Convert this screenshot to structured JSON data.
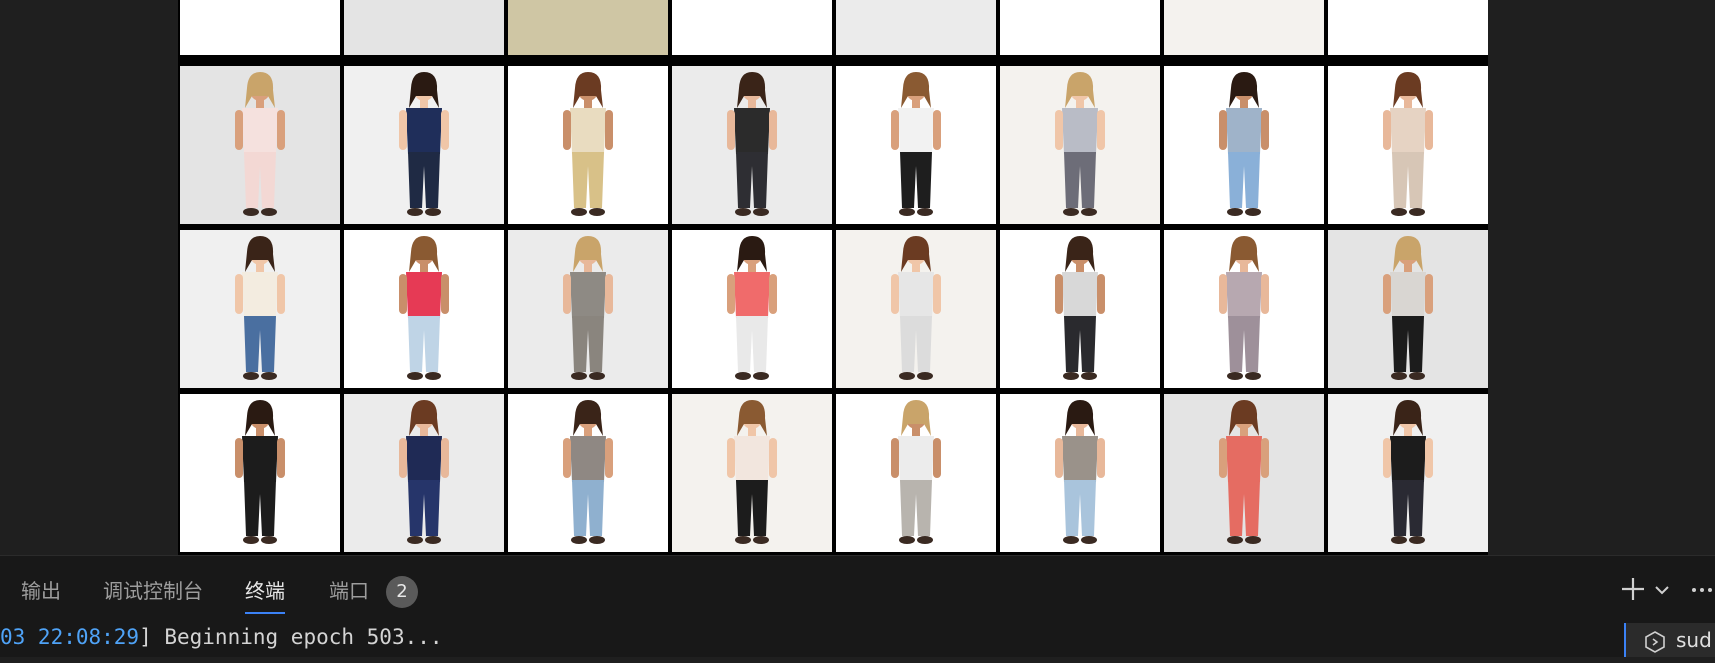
{
  "panel": {
    "tabs": [
      {
        "label": "输出",
        "active": false
      },
      {
        "label": "调试控制台",
        "active": false
      },
      {
        "label": "终端",
        "active": true
      },
      {
        "label": "端口",
        "active": false
      }
    ],
    "ports_badge": "2",
    "new_terminal_icon": "plus-icon",
    "dropdown_icon": "chevron-down-icon",
    "more_icon": "ellipsis-icon",
    "accent_color": "#3b82f6"
  },
  "terminal": {
    "timestamp": "03 22:08:29",
    "message": "] Beginning epoch 503...",
    "session_label": "sud",
    "session_icon": "terminal-icon"
  },
  "image_grid": {
    "rows": 4,
    "cols": 8,
    "description_icon": "fashion-sample-image"
  }
}
